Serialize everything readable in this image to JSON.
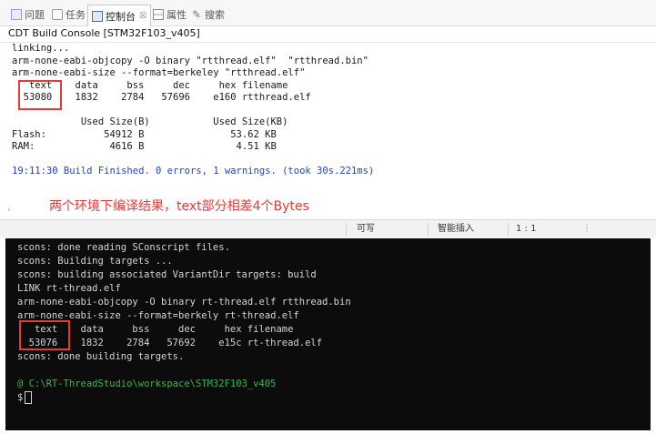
{
  "tabs": [
    {
      "label": "问题",
      "icon": "problems-icon"
    },
    {
      "label": "任务",
      "icon": "tasks-icon"
    },
    {
      "label": "控制台",
      "icon": "console-icon",
      "active": true,
      "close": "☒"
    },
    {
      "label": "属性",
      "icon": "properties-icon"
    },
    {
      "label": "搜索",
      "icon": "search-icon"
    }
  ],
  "console": {
    "title": "CDT Build Console [STM32F103_v405]",
    "lines": [
      "linking...",
      "arm-none-eabi-objcopy -O binary \"rtthread.elf\"  \"rtthread.bin\"",
      "arm-none-eabi-size --format=berkeley \"rtthread.elf\"",
      "   text    data     bss     dec     hex filename",
      "  53080    1832    2784   57696    e160 rtthread.elf",
      "",
      "            Used Size(B)           Used Size(KB)",
      "Flash:          54912 B               53.62 KB",
      "RAM:             4616 B                4.51 KB",
      "",
      "19:11:30 Build Finished. 0 errors, 1 warnings. (took 30s.221ms)"
    ]
  },
  "annotation": "两个环境下编译结果，text部分相差4个Bytes",
  "scroll_left": "‹",
  "status": {
    "writable": "可写",
    "insert_mode": "智能插入",
    "position": "1 : 1",
    "grip": "⋮"
  },
  "terminal": {
    "lines": [
      "scons: done reading SConscript files.",
      "scons: Building targets ...",
      "scons: building associated VariantDir targets: build",
      "LINK rt-thread.elf",
      "arm-none-eabi-objcopy -O binary rt-thread.elf rtthread.bin",
      "arm-none-eabi-size --format=berkely rt-thread.elf",
      "   text    data     bss     dec     hex filename",
      "  53076    1832    2784   57692    e15c rt-thread.elf",
      "scons: done building targets.",
      ""
    ],
    "path": "@ C:\\RT-ThreadStudio\\workspace\\STM32F103_v405",
    "prompt": "$"
  },
  "colors": {
    "highlight": "#e5393a",
    "build_finished": "#1f44c7",
    "terminal_bg": "#0c0c0c",
    "path_green": "#39b54a"
  }
}
